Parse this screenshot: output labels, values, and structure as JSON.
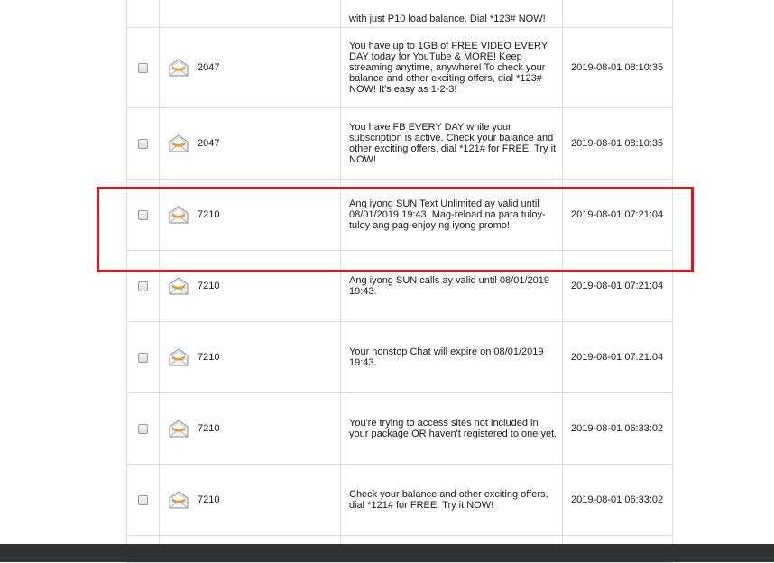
{
  "messages": [
    {
      "sender": "",
      "text": "with just P10 load balance. Dial *123# NOW!",
      "time": "",
      "height": 40
    },
    {
      "sender": "2047",
      "text": "You have up to 1GB of FREE VIDEO EVERY DAY today for YouTube & MORE! Keep streaming anytime, anywhere! To check your balance and other exciting offers, dial *123# NOW! It's easy as 1-2-3!",
      "time": "2019-08-01 08:10:35",
      "height": 89
    },
    {
      "sender": "2047",
      "text": "You have FB EVERY DAY while your subscription is active. Check your balance and other exciting offers, dial *121# for FREE. Try it NOW!",
      "time": "2019-08-01 08:10:35",
      "height": 79
    },
    {
      "sender": "7210",
      "text": "Ang iyong SUN Text Unlimited ay valid until 08/01/2019 19:43. Mag-reload na para tuloy-tuloy ang pag-enjoy ng iyong promo!",
      "time": "2019-08-01 07:21:04",
      "height": 79
    },
    {
      "sender": "7210",
      "text": "Ang iyong SUN calls ay valid until 08/01/2019 19:43.",
      "time": "2019-08-01 07:21:04",
      "height": 79
    },
    {
      "sender": "7210",
      "text": "Your nonstop Chat will expire on 08/01/2019 19:43.",
      "time": "2019-08-01 07:21:04",
      "height": 79
    },
    {
      "sender": "7210",
      "text": "You're trying to access sites not included in your package OR haven't registered to one yet.",
      "time": "2019-08-01 06:33:02",
      "height": 79
    },
    {
      "sender": "7210",
      "text": " Check your balance and other exciting offers, dial *121# for FREE. Try it NOW!",
      "time": "2019-08-01 06:33:02",
      "height": 79
    },
    {
      "sender": "",
      "text": "",
      "time": "",
      "height": 30
    }
  ],
  "highlighted_message_index": 3,
  "icons": {
    "message": "envelope-open-icon",
    "select": "checkbox"
  },
  "colors": {
    "highlight_border": "#e0141e",
    "envelope_seal": "#f0a323",
    "bottom_bar": "#2f3132",
    "grid": "#dcdcdc"
  }
}
